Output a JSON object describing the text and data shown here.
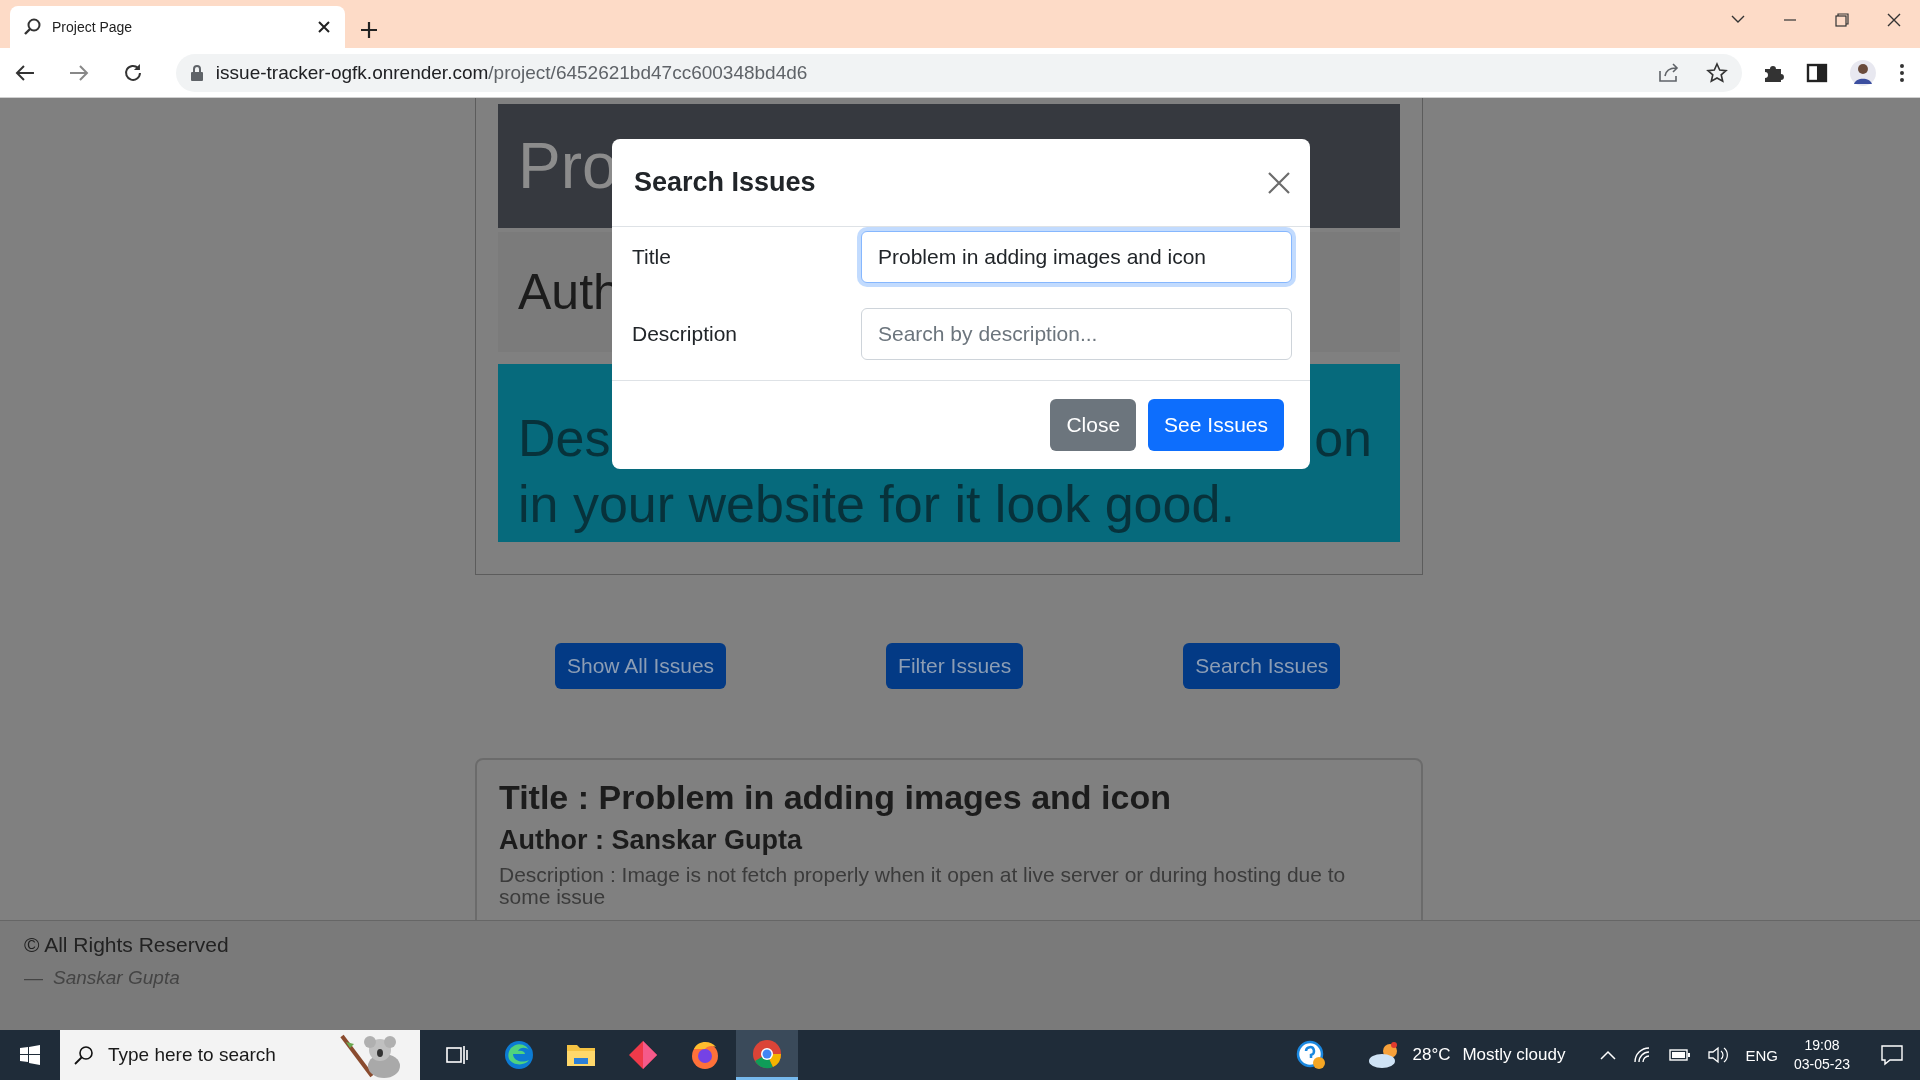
{
  "browser": {
    "tab": {
      "title": "Project Page",
      "selected": true
    },
    "url": {
      "host": "issue-tracker-ogfk.onrender.com",
      "path": "/project/6452621bd47cc600348bd4d6"
    }
  },
  "project_card": {
    "title": "Pro",
    "author": "Auth",
    "description_start": "Des",
    "description_end": "on",
    "description_line": "in your website for it look good."
  },
  "actions": [
    "Show All Issues",
    "Filter Issues",
    "Search Issues"
  ],
  "issue": {
    "title": "Title : Problem in adding images and icon",
    "author": "Author : Sanskar Gupta",
    "description": "Description : Image is not fetch properly when it open at live server or during hosting due to some issue"
  },
  "footer": {
    "copyright": "© All Rights Reserved",
    "dash": "—",
    "author": "Sanskar Gupta"
  },
  "modal": {
    "title": "Search Issues",
    "fields": [
      {
        "label": "Title",
        "value": "Problem in adding images and icon",
        "focused": true
      },
      {
        "label": "Description",
        "placeholder": "Search by description...",
        "focused": false
      }
    ],
    "buttons": [
      {
        "label": "Close",
        "kind": "secondary"
      },
      {
        "label": "See Issues",
        "kind": "primary"
      }
    ]
  },
  "taskbar": {
    "search_placeholder": "Type here to search",
    "apps": [
      {
        "kind": "taskview",
        "selected": false
      },
      {
        "kind": "edge",
        "selected": false
      },
      {
        "kind": "explorer",
        "selected": false
      },
      {
        "kind": "diamond",
        "selected": false
      },
      {
        "kind": "firefox",
        "selected": false
      },
      {
        "kind": "chrome",
        "selected": true
      }
    ],
    "temperature": "28°C",
    "weather": "Mostly cloudy",
    "language": "ENG",
    "time": "19:08",
    "date": "03-05-23"
  }
}
